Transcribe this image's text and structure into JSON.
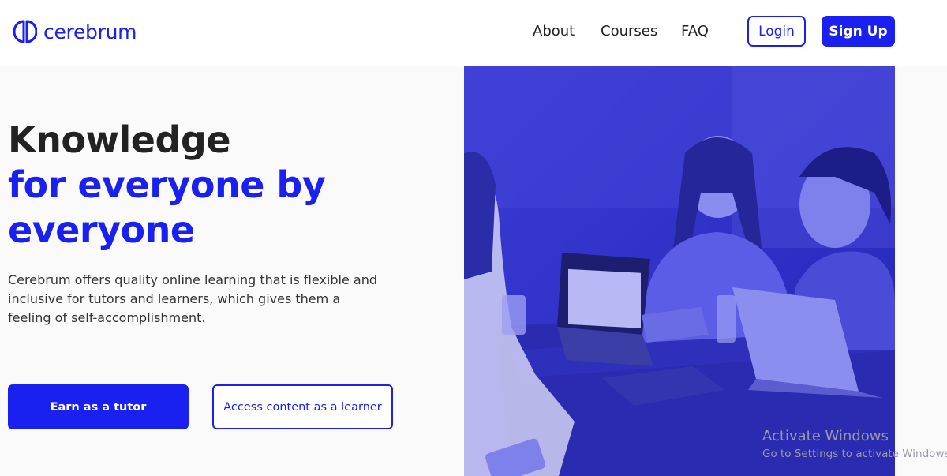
{
  "brand": {
    "name": "cerebrum",
    "logo_icon": "cerebrum-logo-icon",
    "accent": "#1a20f0"
  },
  "nav": {
    "about": "About",
    "courses": "Courses",
    "faq": "FAQ",
    "login": "Login",
    "signup": "Sign Up"
  },
  "hero": {
    "headline_line1": "Knowledge",
    "headline_line2": "for everyone by",
    "headline_line3": "everyone",
    "description": "Cerebrum offers quality online learning that is flexible and inclusive for tutors and learners, which gives them a feeling of self-accomplishment.",
    "cta_tutor": "Earn as a tutor",
    "cta_learner": "Access content as a learner"
  },
  "watermark": {
    "title": "Activate Windows",
    "subtitle": "Go to Settings to activate Windows."
  }
}
